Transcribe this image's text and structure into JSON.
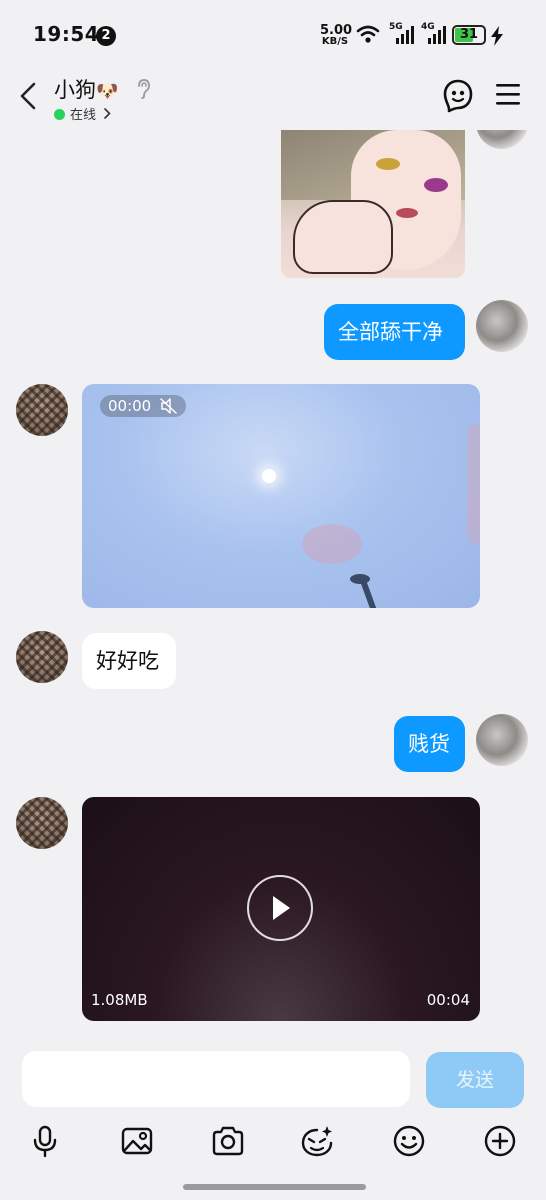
{
  "status_bar": {
    "time": "19:54",
    "notification_count": "2",
    "net_speed_value": "5.00",
    "net_speed_unit": "KB/S",
    "signal1_label": "5G",
    "signal2_label": "4G",
    "battery_level": "31"
  },
  "header": {
    "contact_name": "小狗",
    "name_emoji": "🐶",
    "status": "在线"
  },
  "messages": {
    "m1_text": "全部舔干净",
    "video1_time": "00:00",
    "m3_text": "好好吃",
    "m4_text": "贱货",
    "video2_size": "1.08MB",
    "video2_duration": "00:04"
  },
  "composer": {
    "input_value": "",
    "send_label": "发送"
  },
  "colors": {
    "accent": "#0d99ff",
    "send_disabled": "#8fcaf6",
    "background": "#f1f1f4"
  },
  "icons": [
    "back-icon",
    "ear-icon",
    "mascot-icon",
    "menu-icon",
    "mute-icon",
    "play-icon",
    "microphone-icon",
    "image-icon",
    "camera-icon",
    "sticker-icon",
    "emoji-icon",
    "plus-icon"
  ]
}
